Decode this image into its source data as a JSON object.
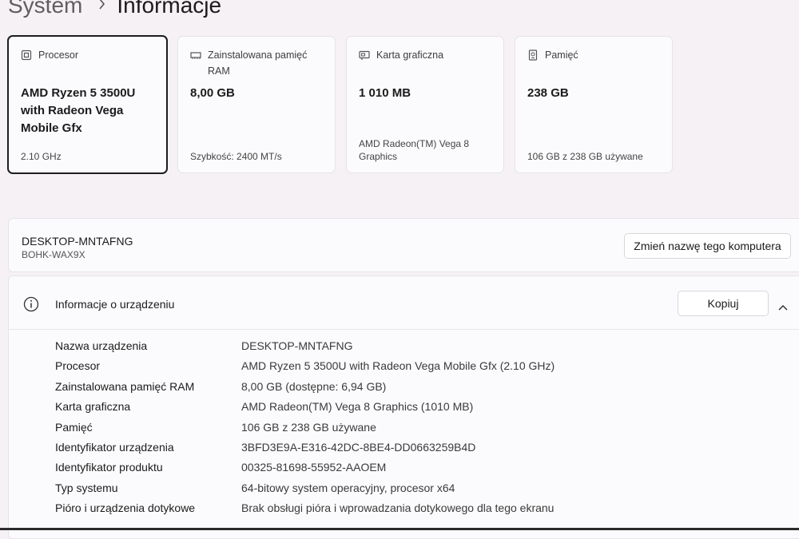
{
  "breadcrumb": {
    "parent": "System",
    "separator_icon": "chevron-right-icon",
    "current": "Informacje"
  },
  "cards": [
    {
      "icon": "cpu-icon",
      "label": "Procesor",
      "value": "AMD Ryzen 5 3500U with Radeon Vega Mobile Gfx",
      "sub": "2.10 GHz",
      "selected": true
    },
    {
      "icon": "ram-icon",
      "label": "Zainstalowana pamięć RAM",
      "value": "8,00 GB",
      "sub": "Szybkość: 2400 MT/s",
      "selected": false
    },
    {
      "icon": "gpu-icon",
      "label": "Karta graficzna",
      "value": "1 010 MB",
      "sub": "AMD Radeon(TM) Vega 8 Graphics",
      "selected": false
    },
    {
      "icon": "storage-icon",
      "label": "Pamięć",
      "value": "238 GB",
      "sub": "106 GB z 238 GB używane",
      "selected": false
    }
  ],
  "computer": {
    "name": "DESKTOP-MNTAFNG",
    "model": "BOHK-WAX9X",
    "rename_button": "Zmień nazwę tego komputera"
  },
  "device_specs": {
    "title": "Informacje o urządzeniu",
    "copy_button": "Kopiuj",
    "rows": [
      {
        "key": "Nazwa urządzenia",
        "value": "DESKTOP-MNTAFNG"
      },
      {
        "key": "Procesor",
        "value": "AMD Ryzen 5 3500U with Radeon Vega Mobile Gfx (2.10 GHz)"
      },
      {
        "key": "Zainstalowana pamięć RAM",
        "value": "8,00 GB (dostępne: 6,94 GB)"
      },
      {
        "key": "Karta graficzna",
        "value": "AMD Radeon(TM) Vega 8 Graphics (1010 MB)"
      },
      {
        "key": "Pamięć",
        "value": "106 GB z 238 GB używane"
      },
      {
        "key": "Identyfikator urządzenia",
        "value": "3BFD3E9A-E316-42DC-8BE4-DD0663259B4D"
      },
      {
        "key": "Identyfikator produktu",
        "value": "00325-81698-55952-AAOEM"
      },
      {
        "key": "Typ systemu",
        "value": "64-bitowy system operacyjny, procesor x64"
      },
      {
        "key": "Pióro i urządzenia dotykowe",
        "value": "Brak obsługi pióra i wprowadzania dotykowego dla tego ekranu"
      }
    ]
  }
}
